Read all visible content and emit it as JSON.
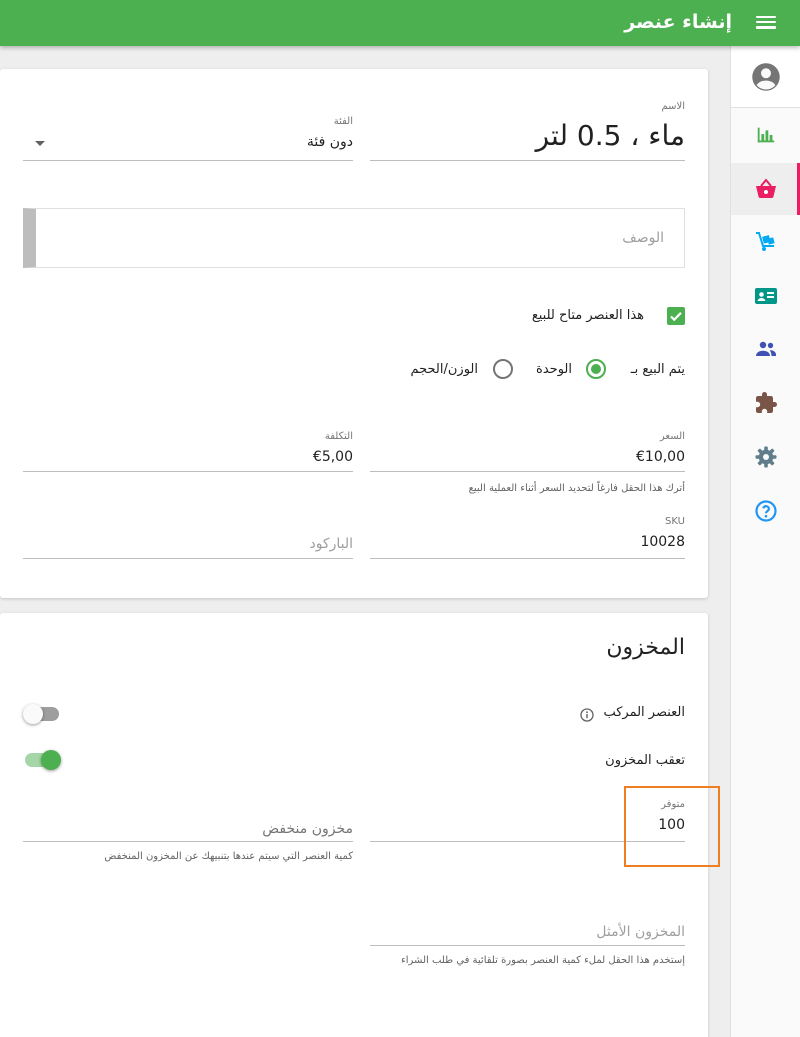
{
  "appbar": {
    "title": "إنشاء عنصر",
    "menu_icon": "menu-icon"
  },
  "sidebar": {
    "items": [
      {
        "name": "account",
        "icon": "account-circle-icon",
        "color": "#757575"
      },
      {
        "name": "reports",
        "icon": "bar-chart-icon",
        "color": "#4caf50"
      },
      {
        "name": "items",
        "icon": "basket-icon",
        "color": "#e91e63",
        "active": true
      },
      {
        "name": "purchases",
        "icon": "dolly-icon",
        "color": "#03a9f4"
      },
      {
        "name": "customers",
        "icon": "contact-card-icon",
        "color": "#009688"
      },
      {
        "name": "employees",
        "icon": "people-icon",
        "color": "#3f51b5"
      },
      {
        "name": "apps",
        "icon": "puzzle-icon",
        "color": "#795548"
      },
      {
        "name": "settings",
        "icon": "gear-icon",
        "color": "#607d8b"
      },
      {
        "name": "help",
        "icon": "help-circle-icon",
        "color": "#2196f3"
      }
    ]
  },
  "item_form": {
    "name_label": "الاسم",
    "name_value": "ماء ، 0.5 لتر",
    "category_label": "الفئة",
    "category_value": "دون فئة",
    "description_placeholder": "الوصف",
    "available_for_sale_label": "هذا العنصر متاح للبيع",
    "available_for_sale": true,
    "sold_by_label": "يتم البيع بـ",
    "sold_by_options": [
      "الوحدة",
      "الوزن/الحجم"
    ],
    "sold_by_selected": "الوحدة",
    "price_label": "السعر",
    "price_value": "€10,00",
    "price_hint": "أترك هذا الحقل فارغاً لتحديد السعر أثناء العملية البيع",
    "cost_label": "التكلفة",
    "cost_value": "€5,00",
    "sku_label": "SKU",
    "sku_value": "10028",
    "barcode_placeholder": "الباركود"
  },
  "inventory": {
    "title": "المخزون",
    "composite_label": "العنصر المركب",
    "composite_on": false,
    "track_stock_label": "تعقب المخزون",
    "track_stock_on": true,
    "in_stock_label": "متوفر",
    "in_stock_value": "100",
    "low_stock_placeholder": "مخزون منخفض",
    "low_stock_hint": "كمية العنصر التي سيتم عندها بتنبيهك عن المخزون المنخفض",
    "optimal_stock_placeholder": "المخزون الأمثل",
    "optimal_stock_hint": "إستخدم هذا الحقل لملء كمية العنصر بصورة تلقائية في طلب الشراء"
  },
  "colors": {
    "primary": "#4caf50",
    "accent": "#e91e63",
    "highlight": "#ef7d22"
  }
}
